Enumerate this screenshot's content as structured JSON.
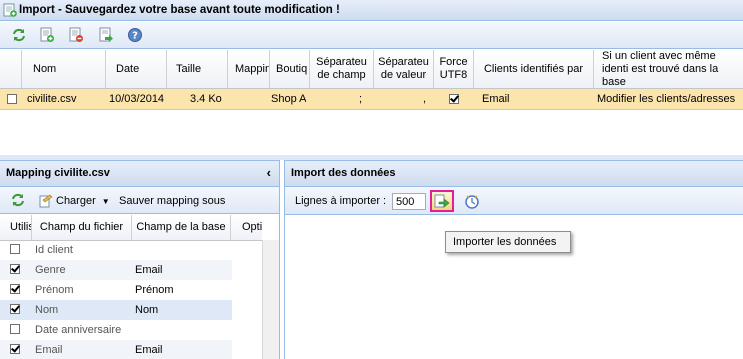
{
  "window": {
    "title": "Import - Sauvegardez votre base avant toute modification !"
  },
  "import_grid": {
    "headers": {
      "nom": "Nom",
      "date": "Date",
      "taille": "Taille",
      "mapping": "Mappin",
      "boutique": "Boutiq",
      "sep_champ": "Séparateu de champ",
      "sep_valeur": "Séparateu de valeur",
      "force_utf8": "Force UTF8",
      "clients_ident": "Clients identifiés par",
      "si_client": "Si un client avec même identi est trouvé dans la base"
    },
    "row": {
      "nom": "civilite.csv",
      "date": "10/03/2014",
      "taille": "3.4 Ko",
      "boutique": "Shop A",
      "sep_champ": ";",
      "sep_valeur": ",",
      "clients_ident": "Email",
      "si_client": "Modifier les clients/adresses"
    }
  },
  "mapping_panel": {
    "title": "Mapping civilite.csv",
    "charger_label": "Charger",
    "sauver_label": "Sauver mapping sous",
    "headers": {
      "utiliser": "Utilis",
      "champ_fichier": "Champ du fichier",
      "champ_base": "Champ de la base",
      "options": "Options"
    },
    "rows": [
      {
        "checked": false,
        "champ_fichier": "Id client",
        "champ_base": ""
      },
      {
        "checked": true,
        "champ_fichier": "Genre",
        "champ_base": "Email"
      },
      {
        "checked": true,
        "champ_fichier": "Prénom",
        "champ_base": "Prénom"
      },
      {
        "checked": true,
        "champ_fichier": "Nom",
        "champ_base": "Nom"
      },
      {
        "checked": false,
        "champ_fichier": "Date anniversaire",
        "champ_base": ""
      },
      {
        "checked": true,
        "champ_fichier": "Email",
        "champ_base": "Email"
      }
    ]
  },
  "import_panel": {
    "title": "Import des données",
    "lines_label": "Lignes à importer :",
    "lines_value": "500",
    "tooltip": "Importer les données"
  },
  "colors": {
    "selected_row": "#fce5ad",
    "highlight_border": "#e41e9a",
    "panel_header": "#cedcef"
  }
}
